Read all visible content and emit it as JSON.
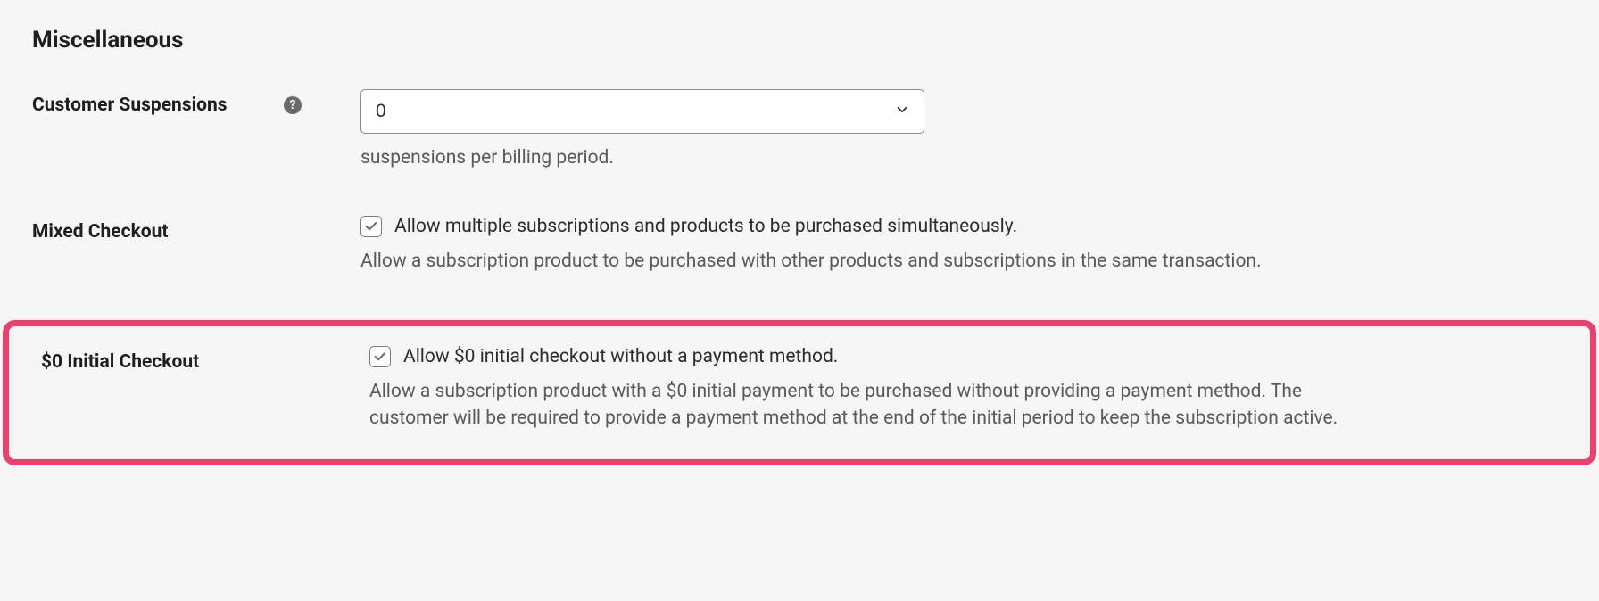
{
  "section": {
    "title": "Miscellaneous"
  },
  "customerSuspensions": {
    "label": "Customer Suspensions",
    "value": "0",
    "helpText": "suspensions per billing period."
  },
  "mixedCheckout": {
    "label": "Mixed Checkout",
    "checkboxLabel": "Allow multiple subscriptions and products to be purchased simultaneously.",
    "helpText": "Allow a subscription product to be purchased with other products and subscriptions in the same transaction.",
    "checked": true
  },
  "zeroInitialCheckout": {
    "label": "$0 Initial Checkout",
    "checkboxLabel": "Allow $0 initial checkout without a payment method.",
    "helpText": "Allow a subscription product with a $0 initial payment to be purchased without providing a payment method. The customer will be required to provide a payment method at the end of the initial period to keep the subscription active.",
    "checked": true
  }
}
